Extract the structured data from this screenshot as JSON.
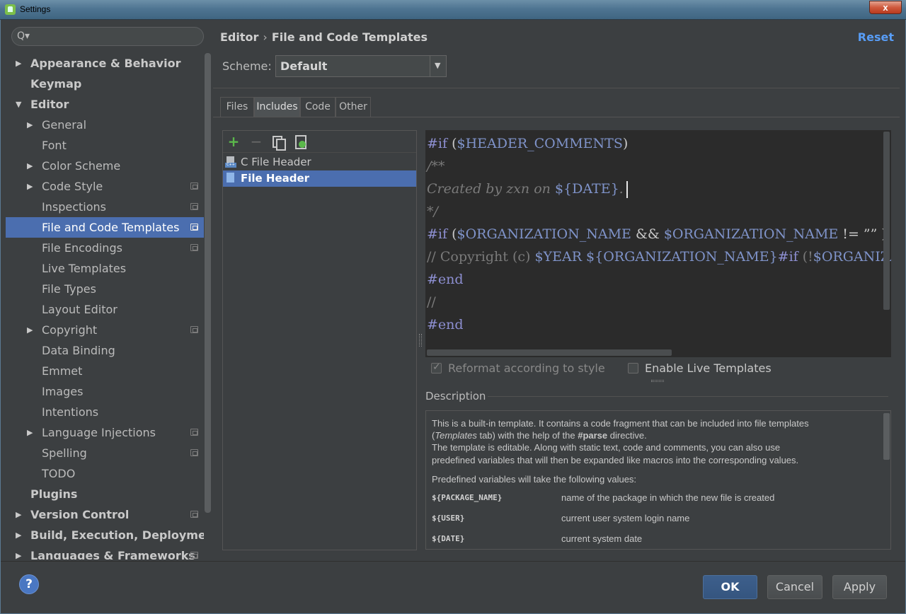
{
  "window": {
    "title": "Settings",
    "close_glyph": "x"
  },
  "search": {
    "icon": "Q▾",
    "value": ""
  },
  "tree": [
    {
      "label": "Appearance & Behavior",
      "arrow": "▶",
      "level": 0,
      "bold": true
    },
    {
      "label": "Keymap",
      "arrow": "",
      "level": 0,
      "bold": true
    },
    {
      "label": "Editor",
      "arrow": "▼",
      "level": 0,
      "bold": true
    },
    {
      "label": "General",
      "arrow": "▶",
      "level": 1
    },
    {
      "label": "Font",
      "arrow": "",
      "level": 1
    },
    {
      "label": "Color Scheme",
      "arrow": "▶",
      "level": 1
    },
    {
      "label": "Code Style",
      "arrow": "▶",
      "level": 1,
      "project": true
    },
    {
      "label": "Inspections",
      "arrow": "",
      "level": 1,
      "project": true
    },
    {
      "label": "File and Code Templates",
      "arrow": "",
      "level": 1,
      "project": true,
      "selected": true
    },
    {
      "label": "File Encodings",
      "arrow": "",
      "level": 1,
      "project": true
    },
    {
      "label": "Live Templates",
      "arrow": "",
      "level": 1
    },
    {
      "label": "File Types",
      "arrow": "",
      "level": 1
    },
    {
      "label": "Layout Editor",
      "arrow": "",
      "level": 1
    },
    {
      "label": "Copyright",
      "arrow": "▶",
      "level": 1,
      "project": true
    },
    {
      "label": "Data Binding",
      "arrow": "",
      "level": 1
    },
    {
      "label": "Emmet",
      "arrow": "",
      "level": 1
    },
    {
      "label": "Images",
      "arrow": "",
      "level": 1
    },
    {
      "label": "Intentions",
      "arrow": "",
      "level": 1
    },
    {
      "label": "Language Injections",
      "arrow": "▶",
      "level": 1,
      "project": true
    },
    {
      "label": "Spelling",
      "arrow": "",
      "level": 1,
      "project": true
    },
    {
      "label": "TODO",
      "arrow": "",
      "level": 1
    },
    {
      "label": "Plugins",
      "arrow": "",
      "level": 0,
      "bold": true
    },
    {
      "label": "Version Control",
      "arrow": "▶",
      "level": 0,
      "bold": true,
      "project": true
    },
    {
      "label": "Build, Execution, Deployment",
      "arrow": "▶",
      "level": 0,
      "bold": true
    },
    {
      "label": "Languages & Frameworks",
      "arrow": "▶",
      "level": 0,
      "bold": true,
      "project": true
    }
  ],
  "header": {
    "crumb_parent": "Editor",
    "crumb_sep": "›",
    "crumb_current": "File and Code Templates",
    "reset": "Reset"
  },
  "scheme": {
    "label": "Scheme:",
    "value": "Default",
    "arrow": "▼"
  },
  "tabs": [
    "Files",
    "Includes",
    "Code",
    "Other"
  ],
  "active_tab": "Includes",
  "toolbar": {
    "add": "+",
    "remove": "−"
  },
  "templates": [
    {
      "name": "C File Header",
      "badge": "C++"
    },
    {
      "name": "File Header",
      "badge": "",
      "selected": true
    }
  ],
  "code": {
    "l1_kw": "#if",
    "l1_rest": " (",
    "l1_var": "$HEADER_COMMENTS",
    "l1_end": ")",
    "l2": "/**",
    "l3_a": "Created by zxn on ",
    "l3_var": "${DATE}",
    "l3_b": ".",
    "l4": "*/",
    "l5_kw": "#if",
    "l5_a": " (",
    "l5_v1": "$ORGANIZATION_NAME",
    "l5_b": " && ",
    "l5_v2": "$ORGANIZATION_NAME",
    "l5_c": " != ”” )",
    "l6_a": "// Copyright (c) ",
    "l6_v1": "$YEAR",
    "l6_b": " ",
    "l6_v2": "${ORGANIZATION_NAME}",
    "l6_kw": "#if",
    "l6_c": " (!",
    "l6_v3": "$ORGANIZATIO",
    "l7": "#end",
    "l8": "//",
    "l9": "#end"
  },
  "options": {
    "reformat": "Reformat according to style",
    "live_templates": "Enable Live Templates"
  },
  "description": {
    "title": "Description",
    "p1_a": "This is a built-in template. It contains a code fragment that can be included into file templates",
    "p1_b_pre": "(",
    "p1_b_em": "Templates",
    "p1_b_mid": " tab) with the help of the ",
    "p1_b_strong": "#parse",
    "p1_b_post": " directive.",
    "p2_a": "The template is editable. Along with static text, code and comments, you can also use",
    "p2_b": "predefined variables that will then be expanded like macros into the corresponding values.",
    "p3": "Predefined variables will take the following values:",
    "vars": [
      {
        "name": "${PACKAGE_NAME}",
        "desc": "name of the package in which the new file is created"
      },
      {
        "name": "${USER}",
        "desc": "current user system login name"
      },
      {
        "name": "${DATE}",
        "desc": "current system date"
      }
    ]
  },
  "buttons": {
    "help": "?",
    "ok": "OK",
    "cancel": "Cancel",
    "apply": "Apply"
  }
}
